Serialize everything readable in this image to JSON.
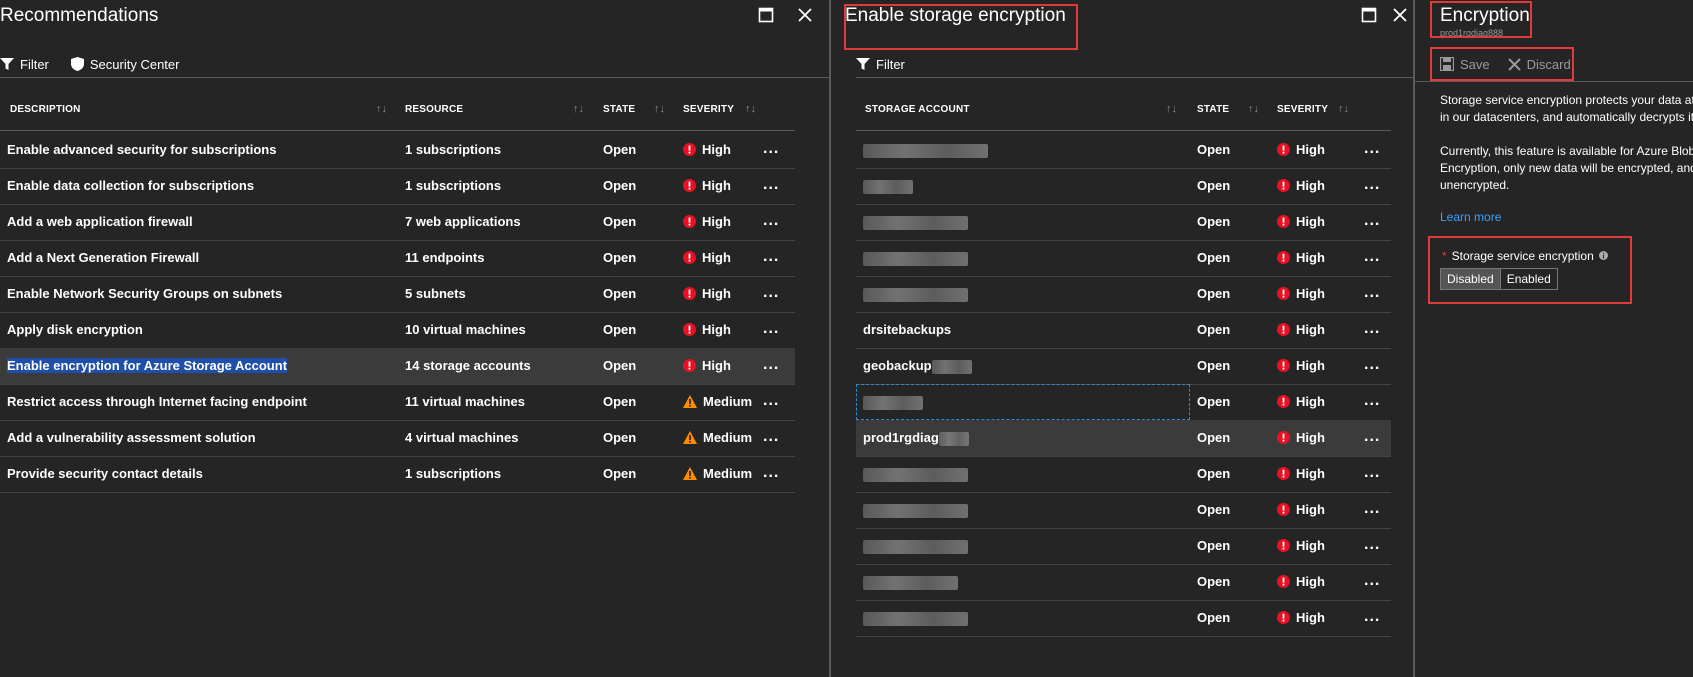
{
  "blades": {
    "recommendations": {
      "title": "Recommendations",
      "toolbar": {
        "filter": "Filter",
        "security_center": "Security Center"
      },
      "columns": {
        "description": "DESCRIPTION",
        "resource": "RESOURCE",
        "state": "STATE",
        "severity": "SEVERITY"
      },
      "rows": [
        {
          "description": "Enable advanced security for subscriptions",
          "resource": "1 subscriptions",
          "state": "Open",
          "severity": "High"
        },
        {
          "description": "Enable data collection for subscriptions",
          "resource": "1 subscriptions",
          "state": "Open",
          "severity": "High"
        },
        {
          "description": "Add a web application firewall",
          "resource": "7 web applications",
          "state": "Open",
          "severity": "High"
        },
        {
          "description": "Add a Next Generation Firewall",
          "resource": "11 endpoints",
          "state": "Open",
          "severity": "High"
        },
        {
          "description": "Enable Network Security Groups on subnets",
          "resource": "5 subnets",
          "state": "Open",
          "severity": "High"
        },
        {
          "description": "Apply disk encryption",
          "resource": "10 virtual machines",
          "state": "Open",
          "severity": "High"
        },
        {
          "description": "Enable encryption for Azure Storage Account",
          "resource": "14 storage accounts",
          "state": "Open",
          "severity": "High"
        },
        {
          "description": "Restrict access through Internet facing endpoint",
          "resource": "11 virtual machines",
          "state": "Open",
          "severity": "Medium"
        },
        {
          "description": "Add a vulnerability assessment solution",
          "resource": "4 virtual machines",
          "state": "Open",
          "severity": "Medium"
        },
        {
          "description": "Provide security contact details",
          "resource": "1 subscriptions",
          "state": "Open",
          "severity": "Medium"
        }
      ]
    },
    "storage_encryption": {
      "title": "Enable storage encryption",
      "toolbar": {
        "filter": "Filter"
      },
      "columns": {
        "account": "STORAGE ACCOUNT",
        "state": "STATE",
        "severity": "SEVERITY"
      },
      "rows": [
        {
          "account": "",
          "state": "Open",
          "severity": "High"
        },
        {
          "account": "",
          "state": "Open",
          "severity": "High"
        },
        {
          "account": "",
          "state": "Open",
          "severity": "High"
        },
        {
          "account": "",
          "state": "Open",
          "severity": "High"
        },
        {
          "account": "",
          "state": "Open",
          "severity": "High"
        },
        {
          "account": "drsitebackups",
          "state": "Open",
          "severity": "High"
        },
        {
          "account": "geobackup",
          "state": "Open",
          "severity": "High"
        },
        {
          "account": "",
          "state": "Open",
          "severity": "High"
        },
        {
          "account": "prod1rgdiag",
          "state": "Open",
          "severity": "High"
        },
        {
          "account": "",
          "state": "Open",
          "severity": "High"
        },
        {
          "account": "",
          "state": "Open",
          "severity": "High"
        },
        {
          "account": "",
          "state": "Open",
          "severity": "High"
        },
        {
          "account": "",
          "state": "Open",
          "severity": "High"
        },
        {
          "account": "",
          "state": "Open",
          "severity": "High"
        }
      ]
    },
    "encryption": {
      "title": "Encryption",
      "subtitle": "prod1rgdiag888",
      "toolbar": {
        "save": "Save",
        "discard": "Discard"
      },
      "desc1_line1": "Storage service encryption protects your data at",
      "desc1_line2": "in our datacenters, and automatically decrypts it",
      "desc2_line1": "Currently, this feature is available for Azure Blob",
      "desc2_line2": "Encryption, only new data will be encrypted, and",
      "desc2_line3": "unencrypted.",
      "learn_more": "Learn more",
      "field_label": "Storage service encryption",
      "options": {
        "disabled": "Disabled",
        "enabled": "Enabled"
      },
      "selected_option": "Disabled"
    }
  },
  "colors": {
    "background": "#252525",
    "high": "#e81123",
    "medium": "#ff8c00",
    "link": "#3aa0ff",
    "highlight_box": "#e03a3a"
  },
  "sort_glyph": "↑↓",
  "more_glyph": "..."
}
